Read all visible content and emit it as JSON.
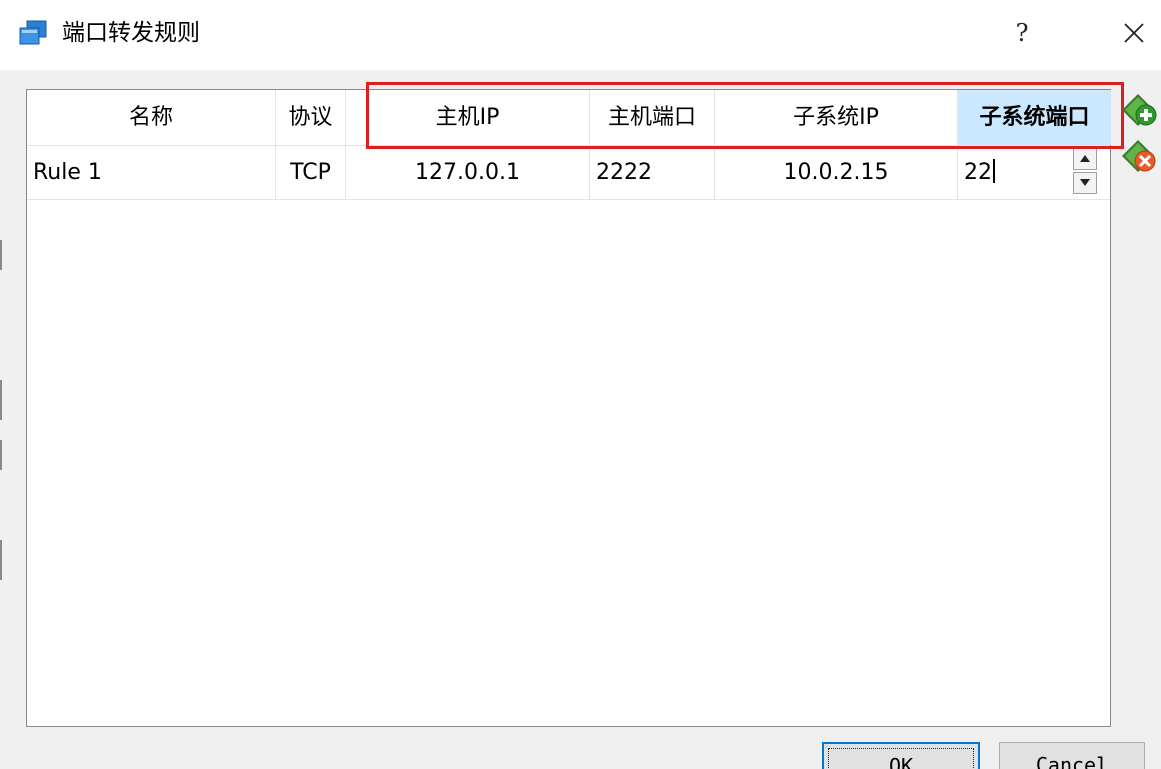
{
  "window": {
    "title": "端口转发规则",
    "help_label": "?"
  },
  "table": {
    "columns": [
      {
        "label": "名称"
      },
      {
        "label": "协议"
      },
      {
        "label": "主机IP"
      },
      {
        "label": "主机端口"
      },
      {
        "label": "子系统IP"
      },
      {
        "label": "子系统端口"
      }
    ],
    "rows": [
      {
        "name": "Rule 1",
        "protocol": "TCP",
        "host_ip": "127.0.0.1",
        "host_port": "2222",
        "guest_ip": "10.0.2.15",
        "guest_port": "22"
      }
    ]
  },
  "buttons": {
    "ok": "OK",
    "cancel": "Cancel"
  },
  "colors": {
    "highlight": "#e11e1e",
    "sorted_header": "#cce8ff",
    "focus_border": "#0078d7"
  }
}
